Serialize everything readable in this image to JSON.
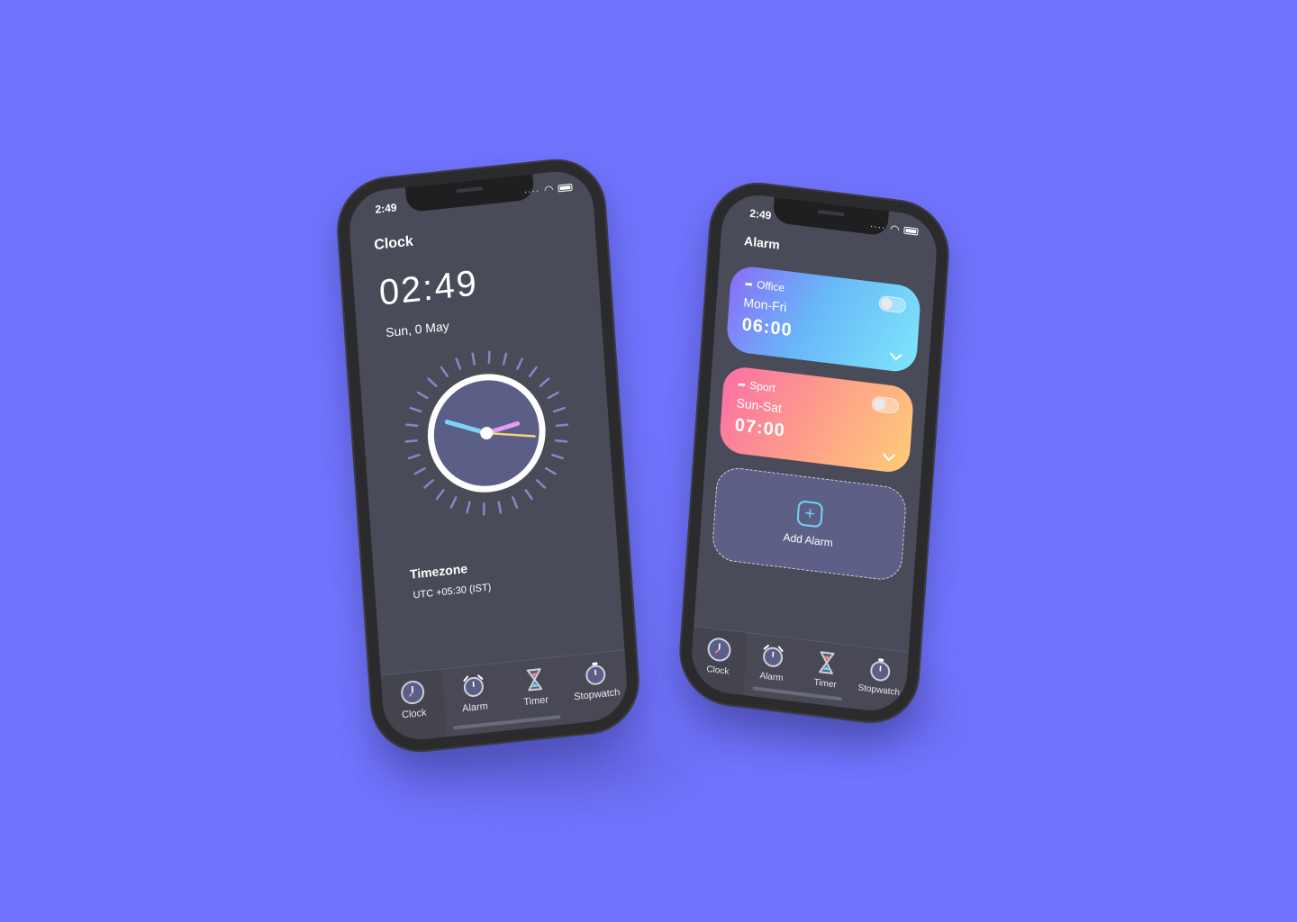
{
  "phone_clock": {
    "status_time": "2:49",
    "title": "Clock",
    "digital_time": "02:49",
    "date": "Sun, 0 May",
    "timezone_title": "Timezone",
    "timezone_value": "UTC +05:30 (IST)"
  },
  "phone_alarm": {
    "status_time": "2:49",
    "title": "Alarm",
    "alarms": [
      {
        "label": "Office",
        "days": "Mon-Fri",
        "time": "06:00"
      },
      {
        "label": "Sport",
        "days": "Sun-Sat",
        "time": "07:00"
      }
    ],
    "add_label": "Add Alarm"
  },
  "tabs": [
    "Clock",
    "Alarm",
    "Timer",
    "Stopwatch"
  ],
  "colors": {
    "background": "#7175fe",
    "screen": "#4a4b58",
    "accent_cyan": "#6fd6f5",
    "minute_hand": "#7fd3f4",
    "hour_hand": "#e69cf2",
    "second_hand": "#f6d37b"
  }
}
